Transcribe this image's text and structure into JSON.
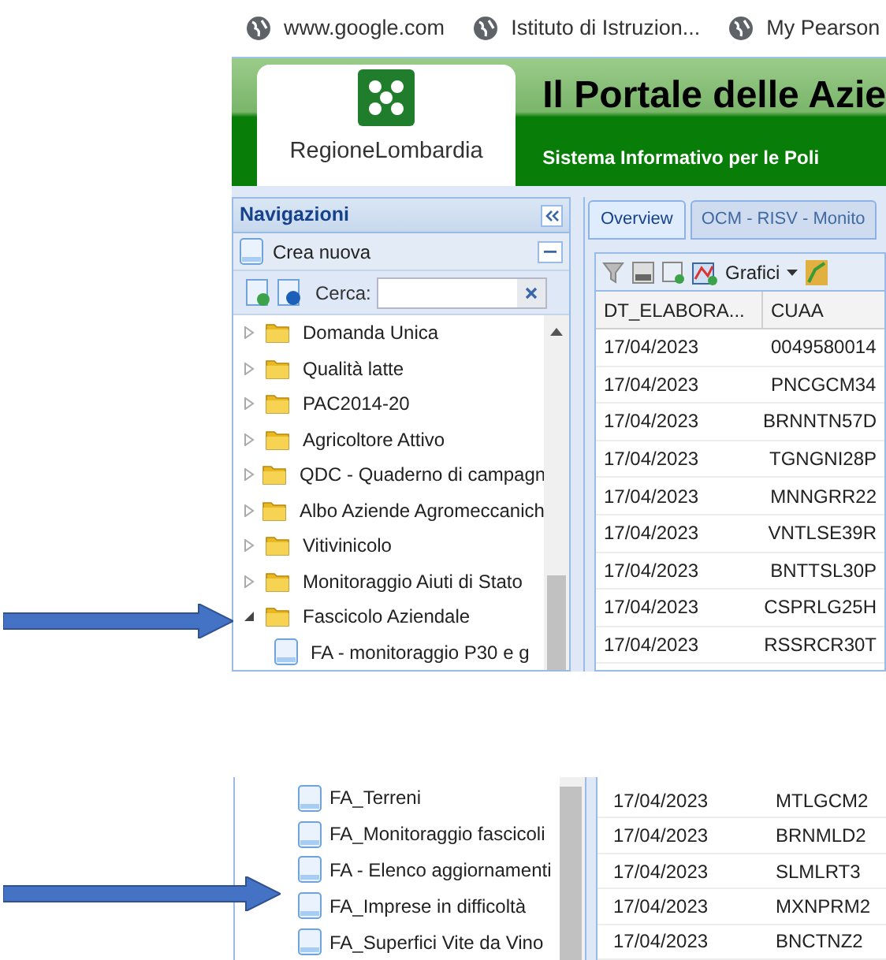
{
  "bookmarks": [
    {
      "label": "www.google.com"
    },
    {
      "label": "Istituto di Istruzion..."
    },
    {
      "label": "My Pearson"
    }
  ],
  "header": {
    "logo_text": "RegioneLombardia",
    "title": "Il Portale delle Azie",
    "subtitle": "Sistema Informativo per le Poli"
  },
  "navigation": {
    "title": "Navigazioni",
    "create": "Crea nuova",
    "search_label": "Cerca:",
    "tree": [
      {
        "label": "Domanda Unica",
        "expanded": false
      },
      {
        "label": "Qualità latte",
        "expanded": false
      },
      {
        "label": "PAC2014-20",
        "expanded": false
      },
      {
        "label": "Agricoltore Attivo",
        "expanded": false
      },
      {
        "label": "QDC - Quaderno di campagn",
        "expanded": false
      },
      {
        "label": "Albo Aziende Agromeccanich",
        "expanded": false
      },
      {
        "label": "Vitivinicolo",
        "expanded": false
      },
      {
        "label": "Monitoraggio Aiuti di Stato",
        "expanded": false
      },
      {
        "label": "Fascicolo Aziendale",
        "expanded": true,
        "children": [
          {
            "label": "FA - monitoraggio P30 e g"
          }
        ]
      }
    ]
  },
  "tabs": [
    {
      "label": "Overview",
      "selected": true
    },
    {
      "label": "OCM - RISV - Monito",
      "selected": false
    }
  ],
  "toolbar": {
    "charts": "Grafici"
  },
  "table": {
    "columns": [
      "DT_ELABORA...",
      "CUAA"
    ],
    "rows": [
      [
        "17/04/2023",
        "0049580014"
      ],
      [
        "17/04/2023",
        "PNCGCM34"
      ],
      [
        "17/04/2023",
        "BRNNTN57D"
      ],
      [
        "17/04/2023",
        "TGNGNI28P"
      ],
      [
        "17/04/2023",
        "MNNGRR22"
      ],
      [
        "17/04/2023",
        "VNTLSE39R"
      ],
      [
        "17/04/2023",
        "BNTTSL30P"
      ],
      [
        "17/04/2023",
        "CSPRLG25H"
      ],
      [
        "17/04/2023",
        "RSSRCR30T"
      ]
    ]
  },
  "lower_fragment": {
    "tree": [
      {
        "label": "FA_Terreni"
      },
      {
        "label": "FA_Monitoraggio fascicoli"
      },
      {
        "label": "FA - Elenco aggiornamenti"
      },
      {
        "label": "FA_Imprese in difficoltà"
      },
      {
        "label": "FA_Superfici Vite da Vino"
      }
    ],
    "rows": [
      [
        "17/04/2023",
        "MTLGCM2"
      ],
      [
        "17/04/2023",
        "BRNMLD2"
      ],
      [
        "17/04/2023",
        "SLMLRT3"
      ],
      [
        "17/04/2023",
        "MXNPRM2"
      ],
      [
        "17/04/2023",
        "BNCTNZ2"
      ]
    ]
  }
}
